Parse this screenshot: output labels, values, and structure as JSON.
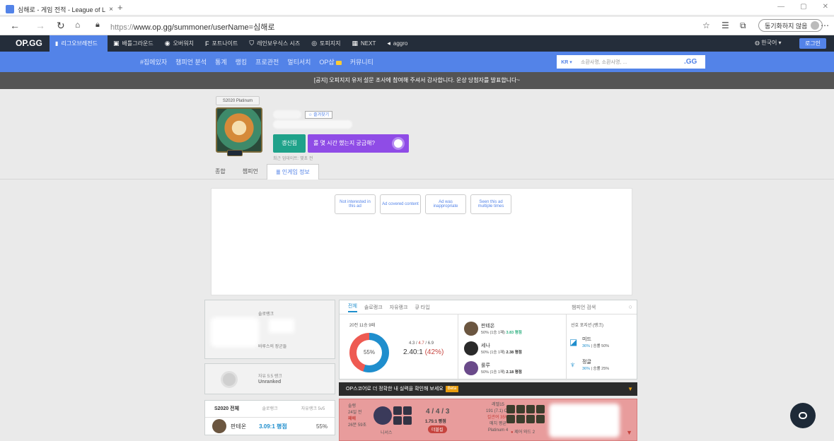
{
  "browser": {
    "tab_title": "심해로 - 게임 전적 - League of L",
    "tab_close": "×",
    "new_tab": "+",
    "url_scheme": "https://",
    "url_rest": "www.op.gg/summoner/userName=심해로",
    "sync_label": "동기화하지 않음"
  },
  "gnb": {
    "logo": "OP.GG",
    "lol": "리그오브레전드",
    "items": [
      "배틀그라운드",
      "오버워치",
      "포트나이트",
      "레인보우식스 시즈",
      "토피지지",
      "NEXT",
      "aggro"
    ],
    "language": "한국어",
    "login": "로그인"
  },
  "subnav": {
    "items": [
      "#집에있자",
      "챔피언 분석",
      "통계",
      "랭킹",
      "프로관전",
      "멀티서치",
      "OP삽",
      "커뮤니티"
    ],
    "region": "KR",
    "search_placeholder": "소환사명, 소환사명, ...",
    "gg": ".GG"
  },
  "notice": "[공지] 오피지지 유저 설문 조사에 참여해 주셔서 감사합니다. 운상 당첨자를 발표합니다~",
  "profile": {
    "season_badge": "S2020 Platinum",
    "favorite": "즐겨찾기",
    "refresh": "갱신됨",
    "promo": "롤 몇 시간 했는지 궁금해?",
    "updated": "최근 업데이트: 몇초 전",
    "tabs": [
      "종합",
      "챔피언",
      "인게임 정보"
    ]
  },
  "ad": {
    "options": [
      "Not interested in this ad",
      "Ad covered content",
      "Ad was inappropriate",
      "Seen this ad multiple times"
    ]
  },
  "rank": {
    "solo_label": "솔로랭크",
    "solo_tier_name": "바루스의 장군들",
    "flex_label": "자유 5:5 랭크",
    "flex_value": "Unranked"
  },
  "champ_box": {
    "tabs": [
      "S2020 전체",
      "솔로랭크",
      "자유랭크 5v5"
    ],
    "row": {
      "name": "판테온",
      "kda": "3.09:1 평점",
      "winrate": "55%"
    }
  },
  "stats": {
    "tabs": [
      "전체",
      "솔로랭크",
      "자유랭크",
      "큐 타입"
    ],
    "champ_search": "챔피언 검색",
    "record": "20전 11승 9패",
    "win_pct": "55%",
    "kda_k": "4.3",
    "kda_d": "4.7",
    "kda_a": "6.9",
    "ratio": "2.40:1",
    "ratio_pct": "(42%)",
    "most": [
      {
        "name": "판테온",
        "sub": "50% (1승 1패)",
        "kda": "3.83 평점",
        "kda_class": "k1"
      },
      {
        "name": "세나",
        "sub": "50% (1승 1패)",
        "kda": "2.38 평점",
        "kda_class": "k2"
      },
      {
        "name": "룰루",
        "sub": "50% (1승 1패)",
        "kda": "2.18 평점",
        "kda_class": "k2"
      }
    ],
    "pos_title": "선호 포지션 (랭크)",
    "positions": [
      {
        "name": "미드",
        "pct": "36%",
        "wr": "승률 50%"
      },
      {
        "name": "정글",
        "pct": "36%",
        "wr": "승률 25%"
      }
    ]
  },
  "opscore": {
    "text": "OP스코어로 더 정확한 내 실력을 확인해 보세요",
    "beta": "Beta"
  },
  "game": {
    "type": "솔랭",
    "ago": "24일 전",
    "result": "패배",
    "duration": "26분 59초",
    "champion": "니서스",
    "kda_k": "4",
    "kda_d": "4",
    "kda_a": "3",
    "kda_ratio": "1.75:1 평점",
    "multi": "더블킬",
    "level": "레벨15",
    "cs": "191 (7.1) CS",
    "kp": "킬관여 35%",
    "avg": "매치 평균",
    "tier": "Platinum 4",
    "ward": "제어 와드 2"
  }
}
